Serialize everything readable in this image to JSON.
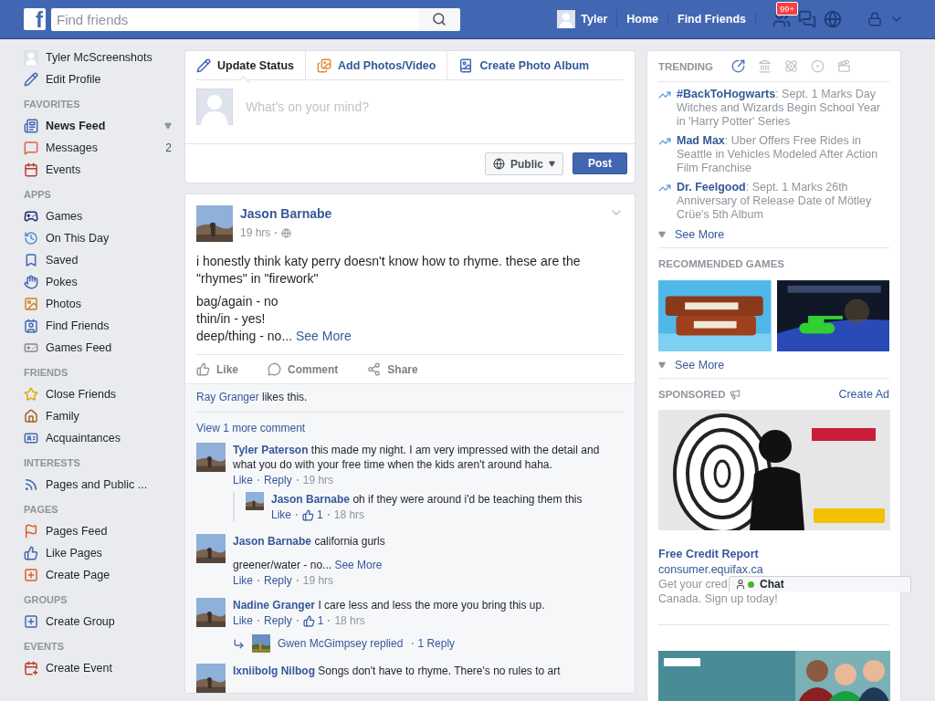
{
  "top_bar": {
    "logo": "f",
    "search": {
      "placeholder": "Find friends"
    },
    "user": "Tyler",
    "nav": [
      "Home",
      "Find Friends"
    ],
    "friend_requests_badge": "99+"
  },
  "sidebar": {
    "profile": {
      "name": "Tyler McScreenshots",
      "edit": "Edit Profile"
    },
    "sections": [
      {
        "heading": "FAVORITES",
        "items": [
          {
            "label": "News Feed",
            "selected": true
          },
          {
            "label": "Messages",
            "selected": false,
            "count": "2"
          },
          {
            "label": "Events",
            "selected": false
          }
        ]
      },
      {
        "heading": "APPS",
        "items": [
          {
            "label": "Games",
            "selected": false
          },
          {
            "label": "On This Day",
            "selected": false
          },
          {
            "label": "Saved",
            "selected": false
          },
          {
            "label": "Pokes",
            "selected": false
          },
          {
            "label": "Photos",
            "selected": false
          },
          {
            "label": "Find Friends",
            "selected": false
          },
          {
            "label": "Games Feed",
            "selected": false
          }
        ]
      },
      {
        "heading": "FRIENDS",
        "items": [
          {
            "label": "Close Friends",
            "selected": false
          },
          {
            "label": "Family",
            "selected": false
          },
          {
            "label": "Acquaintances",
            "selected": false
          }
        ]
      },
      {
        "heading": "INTERESTS",
        "items": [
          {
            "label": "Pages and Public ...",
            "selected": false
          }
        ]
      },
      {
        "heading": "PAGES",
        "items": [
          {
            "label": "Pages Feed",
            "selected": false
          },
          {
            "label": "Like Pages",
            "selected": false
          },
          {
            "label": "Create Page",
            "selected": false
          }
        ]
      },
      {
        "heading": "GROUPS",
        "items": [
          {
            "label": "Create Group",
            "selected": false
          }
        ]
      },
      {
        "heading": "EVENTS",
        "items": [
          {
            "label": "Create Event",
            "selected": false
          }
        ]
      }
    ]
  },
  "composer": {
    "tabs": [
      {
        "label": "Update Status",
        "selected": true
      },
      {
        "label": "Add Photos/Video",
        "selected": false
      },
      {
        "label": "Create Photo Album",
        "selected": false
      }
    ],
    "placeholder": "What's on your mind?",
    "privacy": "Public",
    "post_button": "Post"
  },
  "post": {
    "author": "Jason Barnabe",
    "time": "19 hrs",
    "paragraph": "i honestly think katy perry doesn't know how to rhyme. these are the \"rhymes\" in \"firework\"",
    "lines": [
      "bag/again - no",
      "thin/in - yes!",
      "deep/thing - no..."
    ],
    "see_more": "See More",
    "actions": [
      "Like",
      "Comment",
      "Share"
    ],
    "likes": {
      "name": "Ray Granger",
      "text": " likes this."
    },
    "view_more": "View 1 more comment",
    "comments": [
      {
        "author": "Tyler Paterson",
        "text": "this made my night. I am very impressed with the detail and what you do with your free time when the kids aren't around haha.",
        "like": "Like",
        "reply": "Reply",
        "time": "19 hrs",
        "replies": [
          {
            "author": "Jason Barnabe",
            "text": "oh if they were around i'd be teaching them this",
            "like": "Like",
            "likes": "1",
            "time": "18 hrs"
          }
        ]
      },
      {
        "author": "Jason Barnabe",
        "text": "california gurls",
        "more_text": "greener/water - no...",
        "see_more": "See More",
        "like": "Like",
        "reply": "Reply",
        "time": "19 hrs"
      },
      {
        "author": "Nadine Granger",
        "text": "I care less and less the more you bring this up.",
        "like": "Like",
        "reply": "Reply",
        "likes": "1",
        "time": "18 hrs",
        "reply_summary": {
          "text": "Gwen McGimpsey replied",
          "count": "1 Reply"
        }
      },
      {
        "author": "Ixniibolg Nilbog",
        "text": "Songs don't have to rhyme. There's no rules to art"
      }
    ]
  },
  "right": {
    "trending": {
      "title": "TRENDING",
      "tabs": [
        {
          "selected": true
        },
        {
          "selected": false
        },
        {
          "selected": false
        },
        {
          "selected": false
        },
        {
          "selected": false
        }
      ],
      "items": [
        {
          "topic": "#BackToHogwarts",
          "text": ": Sept. 1 Marks Day Witches and Wizards Begin School Year in 'Harry Potter' Series"
        },
        {
          "topic": "Mad Max",
          "text": ": Uber Offers Free Rides in Seattle in Vehicles Modeled After Action Film Franchise"
        },
        {
          "topic": "Dr. Feelgood",
          "text": ": Sept. 1 Marks 26th Anniversary of Release Date of Mötley Crüe's 5th Album"
        }
      ],
      "see_more": "See More"
    },
    "games": {
      "title": "RECOMMENDED GAMES",
      "see_more": "See More"
    },
    "sponsored": {
      "title": "SPONSORED",
      "create_ad": "Create Ad",
      "ad": {
        "title": "Free Credit Report",
        "url": "consumer.equifax.ca",
        "description": [
          "Get your cred",
          "Canada. Sign up today!"
        ]
      }
    }
  },
  "chat": {
    "label": "Chat",
    "online": true
  }
}
